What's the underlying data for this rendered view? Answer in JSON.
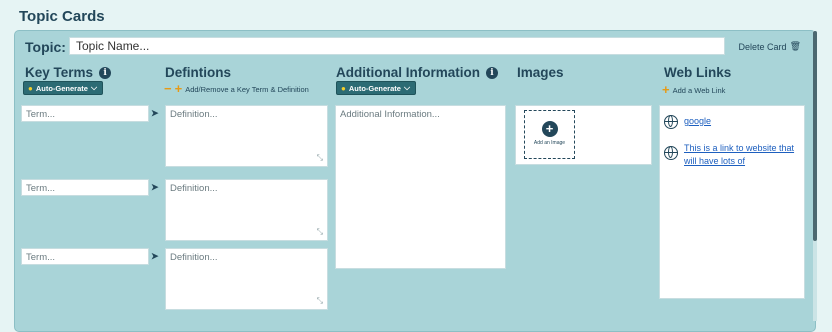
{
  "page_title": "Topic Cards",
  "topic": {
    "label": "Topic:",
    "value": "Topic Name...",
    "delete_label": "Delete Card"
  },
  "columns": {
    "key_terms": {
      "title": "Key Terms",
      "auto_generate": "Auto-Generate"
    },
    "definitions": {
      "title": "Defintions",
      "add_remove": "Add/Remove a Key Term & Definition"
    },
    "additional": {
      "title": "Additional Information",
      "auto_generate": "Auto-Generate",
      "placeholder": "Additional Information..."
    },
    "images": {
      "title": "Images",
      "add_image": "Add an Image"
    },
    "web_links": {
      "title": "Web Links",
      "add_link": "Add a Web Link"
    }
  },
  "rows": [
    {
      "term_placeholder": "Term...",
      "definition_placeholder": "Definition..."
    },
    {
      "term_placeholder": "Term...",
      "definition_placeholder": "Definition..."
    },
    {
      "term_placeholder": "Term...",
      "definition_placeholder": "Definition..."
    }
  ],
  "links": [
    {
      "text": "google"
    },
    {
      "text": "This is a link to website that will have lots of"
    }
  ],
  "colors": {
    "accent": "#23475a",
    "card_bg": "#a9d4d8",
    "button_bg": "#2c6b74",
    "plus": "#e69a16",
    "link": "#1d5fbf"
  }
}
